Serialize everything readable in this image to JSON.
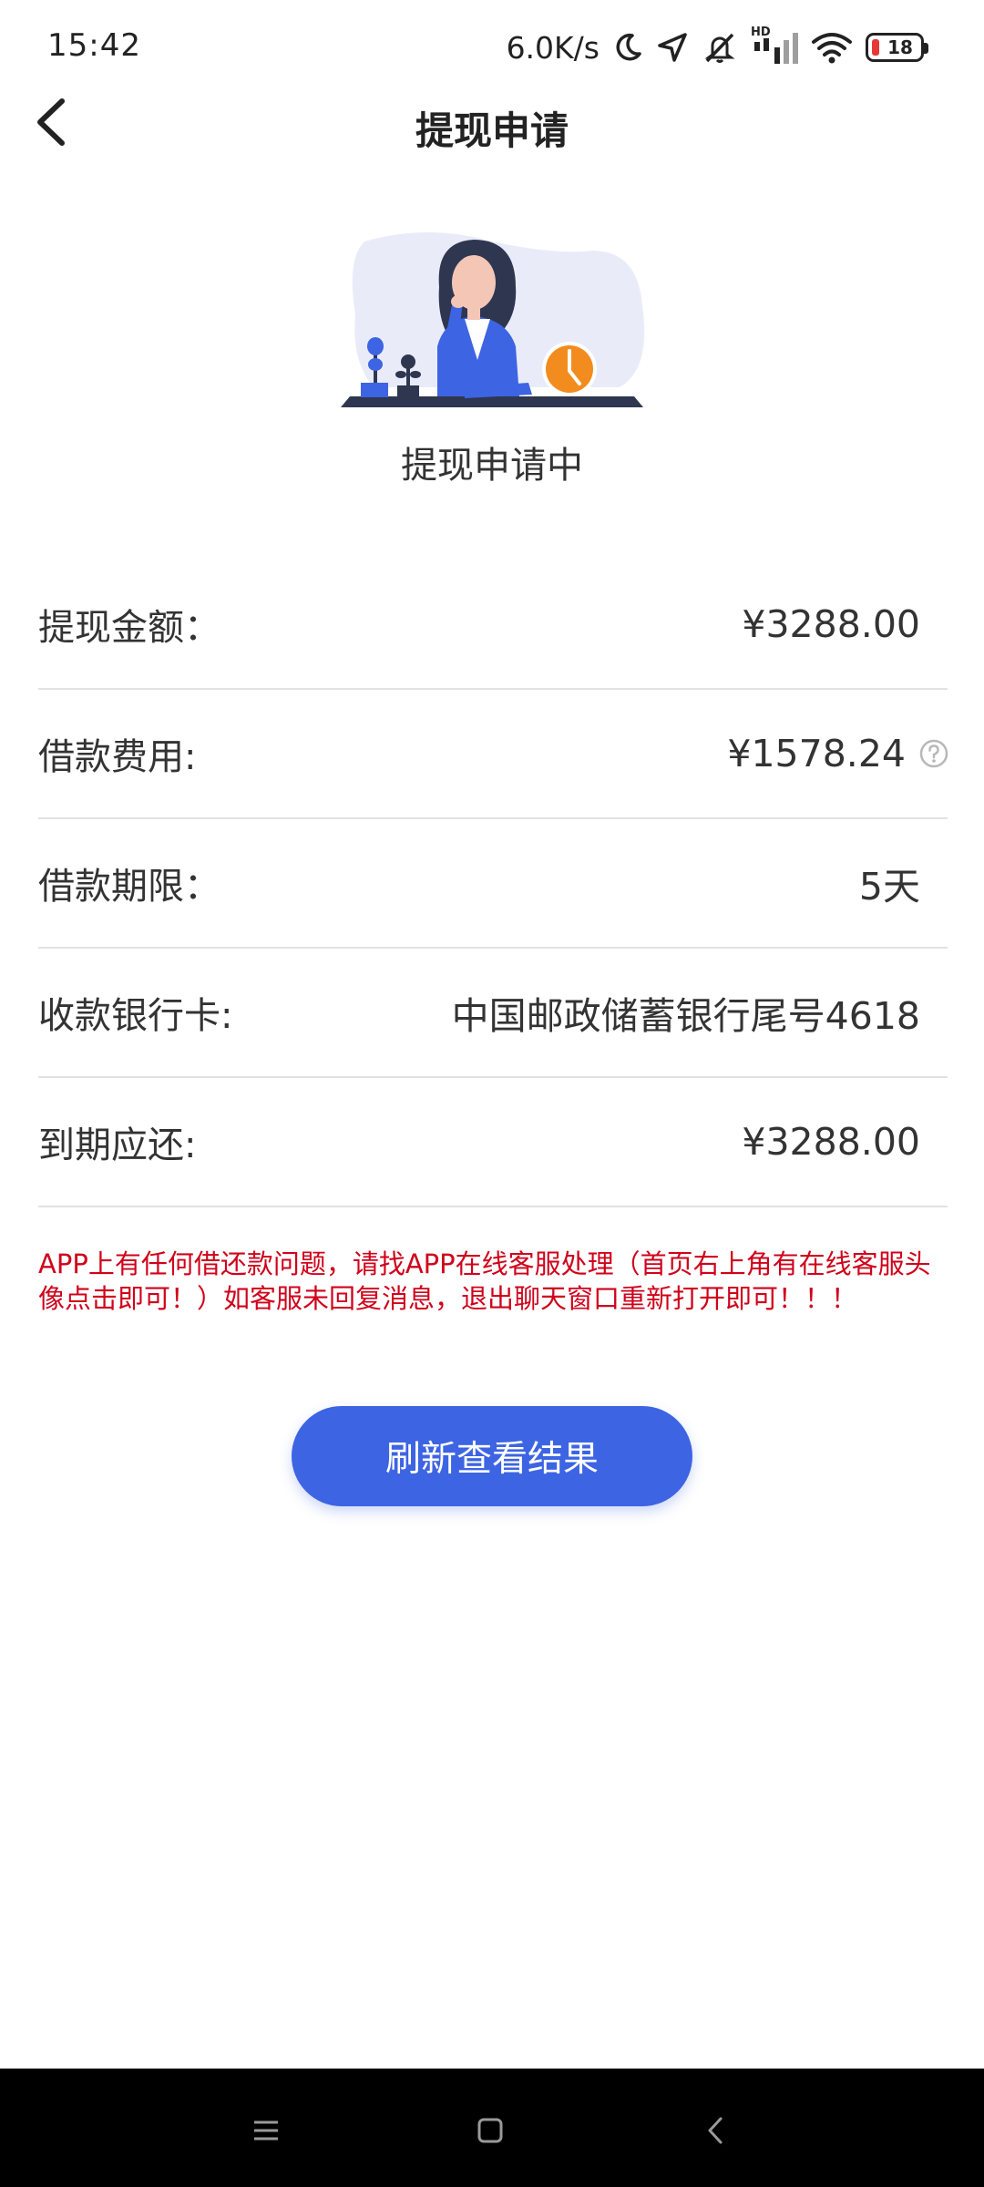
{
  "status_bar": {
    "time": "15:42",
    "net_speed": "6.0K/s",
    "signal_badge": "HD",
    "battery_level": "18"
  },
  "header": {
    "title": "提现申请"
  },
  "status": {
    "label": "提现申请中"
  },
  "info_rows": [
    {
      "label": "提现金额：",
      "value": "¥3288.00"
    },
    {
      "label": "借款费用:",
      "value": "¥1578.24"
    },
    {
      "label": "借款期限：",
      "value": "5天"
    },
    {
      "label": "收款银行卡:",
      "value": "中国邮政储蓄银行尾号4618"
    },
    {
      "label": "到期应还:",
      "value": "¥3288.00"
    }
  ],
  "notice": "APP上有任何借还款问题，请找APP在线客服处理（首页右上角有在线客服头像点击即可！）如客服未回复消息，退出聊天窗口重新打开即可！！！",
  "button": {
    "label": "刷新查看结果"
  },
  "colors": {
    "accent": "#3d64e3",
    "notice": "#d0021b",
    "divider": "#e2e2e2",
    "illustration_orange": "#f28c1e"
  }
}
